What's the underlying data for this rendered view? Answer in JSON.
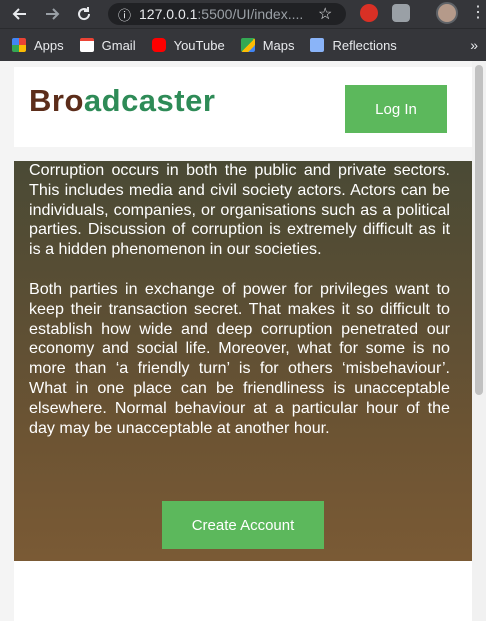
{
  "browser": {
    "url_host": "127.0.0.1",
    "url_rest": ":5500/UI/index....",
    "bookmarks": [
      {
        "label": "Apps",
        "icon": "apps-grid-icon",
        "color": "#4285f4"
      },
      {
        "label": "Gmail",
        "icon": "gmail-icon",
        "color": "#ea4335"
      },
      {
        "label": "YouTube",
        "icon": "youtube-icon",
        "color": "#ff0000"
      },
      {
        "label": "Maps",
        "icon": "maps-icon",
        "color": "#34a853"
      },
      {
        "label": "Reflections",
        "icon": "reflections-icon",
        "color": "#8ab4f8"
      }
    ],
    "more": "»"
  },
  "header": {
    "brand_part1": "Bro",
    "brand_part2": "adcaster",
    "login_label": "Log In"
  },
  "hero": {
    "paragraph1": "Corruption occurs in both the public and private sectors. This includes media and civil society actors. Actors can be individuals, companies, or organisations such as a political parties. Discussion of corruption is extremely difficult as it is a hidden phenomenon in our societies.",
    "paragraph2": "Both parties in exchange of power for privileges want to keep their transaction secret. That makes it so difficult to establish how wide and deep corruption penetrated our economy and social life. Moreover, what for some is no more than ‘a friendly turn’ is for others ‘misbehaviour’. What in one place can be friendliness is unacceptable elsewhere. Normal behaviour at a particular hour of the day may be unacceptable at another hour.",
    "create_label": "Create Account"
  },
  "colors": {
    "brand_dark": "#5c2d1a",
    "brand_green": "#2e8b57",
    "button_green": "#5cb85c"
  }
}
